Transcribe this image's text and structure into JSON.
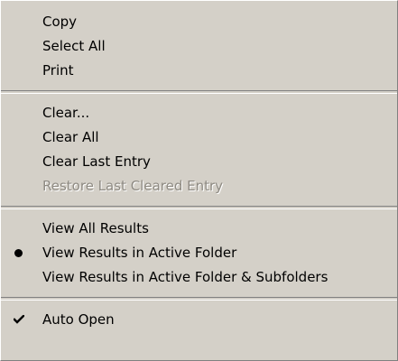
{
  "menu": {
    "group1": [
      {
        "label": "Copy"
      },
      {
        "label": "Select All"
      },
      {
        "label": "Print"
      }
    ],
    "group2": [
      {
        "label": "Clear..."
      },
      {
        "label": "Clear All"
      },
      {
        "label": "Clear Last Entry"
      },
      {
        "label": "Restore Last Cleared Entry",
        "disabled": true
      }
    ],
    "group3": [
      {
        "label": "View All Results"
      },
      {
        "label": "View Results in Active Folder",
        "selected": true,
        "mark": "bullet-icon"
      },
      {
        "label": "View Results in Active Folder & Subfolders"
      }
    ],
    "group4": [
      {
        "label": "Auto Open",
        "checked": true,
        "mark": "checkmark-icon"
      }
    ]
  }
}
